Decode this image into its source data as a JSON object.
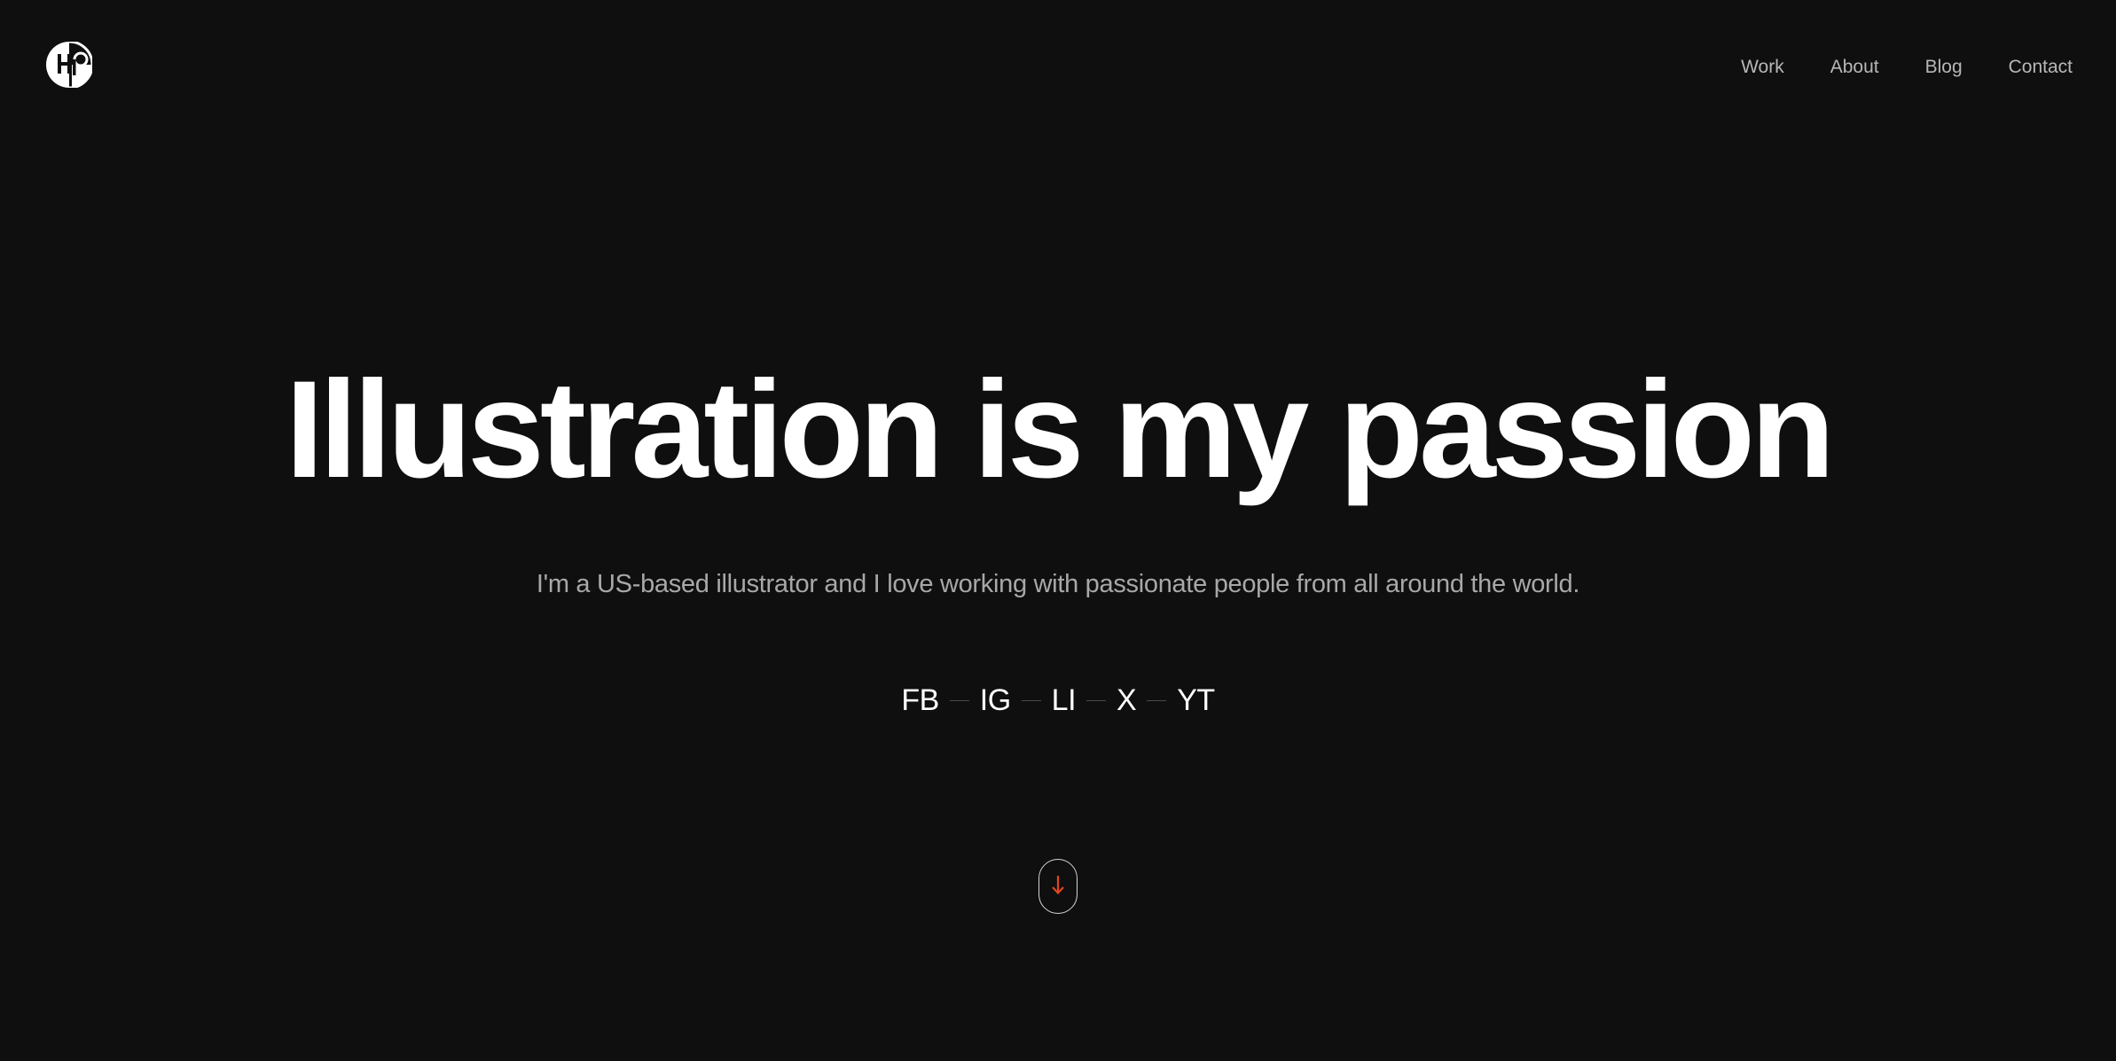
{
  "header": {
    "logo_icon": "hp-monogram-logo-icon",
    "nav": [
      {
        "label": "Work"
      },
      {
        "label": "About"
      },
      {
        "label": "Blog"
      },
      {
        "label": "Contact"
      }
    ]
  },
  "hero": {
    "headline": "Illustration is my passion",
    "subline": "I'm a US-based illustrator and I love working with passionate people from all around the world.",
    "socials": [
      {
        "label": "FB"
      },
      {
        "label": "IG"
      },
      {
        "label": "LI"
      },
      {
        "label": "X"
      },
      {
        "label": "YT"
      }
    ],
    "scroll_icon": "arrow-down-icon"
  },
  "colors": {
    "background": "#0f0f0f",
    "text": "#ffffff",
    "muted": "#a8a8a8",
    "accent": "#e0461f"
  }
}
